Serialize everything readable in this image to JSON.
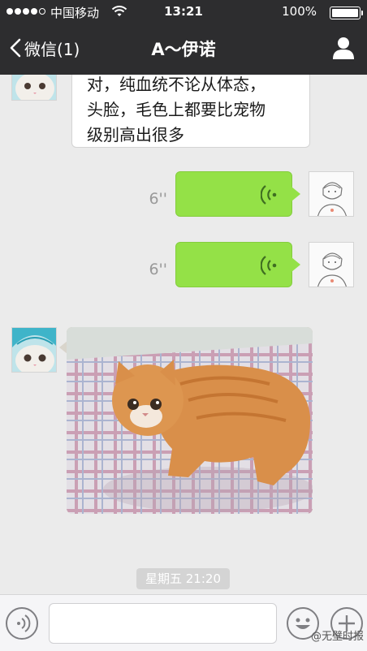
{
  "status_bar": {
    "carrier": "中国移动",
    "time": "13:21",
    "battery": "100%",
    "icons": [
      "signal-dots",
      "wifi-icon",
      "battery-icon"
    ]
  },
  "header": {
    "back_label": "微信(1)",
    "title": "A～伊诺",
    "icons": [
      "chevron-left-icon",
      "contact-icon"
    ]
  },
  "messages": [
    {
      "from": "contact",
      "type": "text",
      "lines": [
        "对，纯血统不论从体态，",
        "头脸，毛色上都要比宠物",
        "级别高出很多"
      ]
    },
    {
      "from": "me",
      "type": "voice",
      "duration": "6''"
    },
    {
      "from": "me",
      "type": "voice",
      "duration": "6''"
    },
    {
      "from": "contact",
      "type": "image",
      "alt": "orange-kitten-photo"
    }
  ],
  "timestamp": "星期五 21:20",
  "input_bar": {
    "placeholder": "",
    "icons": [
      "voice-mode-icon",
      "emoji-icon",
      "plus-icon"
    ]
  },
  "watermark": "@无壁时报",
  "colors": {
    "header_bg": "#2d2d2f",
    "chat_bg": "#ebebeb",
    "voice_bubble": "#94e147",
    "text_bubble": "#ffffff"
  }
}
